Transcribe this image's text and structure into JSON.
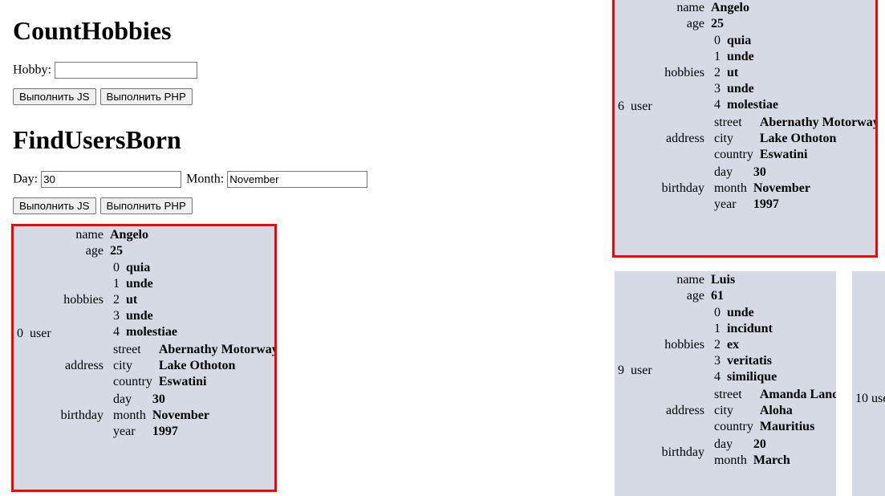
{
  "page": {
    "background": "#ffffff",
    "panel_background": "#d6dae4",
    "panel_border_color": "#ff0000"
  },
  "forms": [
    {
      "title": "CountHobbies",
      "fields": [
        {
          "label": "Hobby:",
          "value": "",
          "placeholder": ""
        }
      ],
      "buttons": [
        {
          "label": "Выполнить JS"
        },
        {
          "label": "Выполнить PHP"
        }
      ]
    },
    {
      "title": "FindUsersBorn",
      "fields": [
        {
          "label": "Day:",
          "value": "30",
          "placeholder": ""
        },
        {
          "label": "Month:",
          "value": "November",
          "placeholder": ""
        }
      ],
      "buttons": [
        {
          "label": "Выполнить JS"
        },
        {
          "label": "Выполнить PHP"
        }
      ]
    }
  ],
  "panels": [
    {
      "id": "panel-0",
      "index": "0",
      "root_key": "user",
      "bordered": true,
      "truncated": false,
      "rows": {
        "name_key": "name",
        "name_val": "Angelo",
        "age_key": "age",
        "age_val": "25",
        "hobbies_key": "hobbies",
        "hobbies": [
          {
            "i": "0",
            "v": "quia"
          },
          {
            "i": "1",
            "v": "unde"
          },
          {
            "i": "2",
            "v": "ut"
          },
          {
            "i": "3",
            "v": "unde"
          },
          {
            "i": "4",
            "v": "molestiae"
          }
        ],
        "address_key": "address",
        "address": [
          {
            "k": "street",
            "v": "Abernathy Motorway"
          },
          {
            "k": "city",
            "v": "Lake Othoton"
          },
          {
            "k": "country",
            "v": "Eswatini"
          }
        ],
        "birthday_key": "birthday",
        "birthday": [
          {
            "k": "day",
            "v": "30"
          },
          {
            "k": "month",
            "v": "November"
          },
          {
            "k": "year",
            "v": "1997"
          }
        ]
      }
    },
    {
      "id": "panel-6",
      "index": "6",
      "root_key": "user",
      "bordered": true,
      "truncated": false,
      "rows": {
        "name_key": "name",
        "name_val": "Angelo",
        "age_key": "age",
        "age_val": "25",
        "hobbies_key": "hobbies",
        "hobbies": [
          {
            "i": "0",
            "v": "quia"
          },
          {
            "i": "1",
            "v": "unde"
          },
          {
            "i": "2",
            "v": "ut"
          },
          {
            "i": "3",
            "v": "unde"
          },
          {
            "i": "4",
            "v": "molestiae"
          }
        ],
        "address_key": "address",
        "address": [
          {
            "k": "street",
            "v": "Abernathy Motorway"
          },
          {
            "k": "city",
            "v": "Lake Othoton"
          },
          {
            "k": "country",
            "v": "Eswatini"
          }
        ],
        "birthday_key": "birthday",
        "birthday": [
          {
            "k": "day",
            "v": "30"
          },
          {
            "k": "month",
            "v": "November"
          },
          {
            "k": "year",
            "v": "1997"
          }
        ]
      }
    },
    {
      "id": "panel-9",
      "index": "9",
      "root_key": "user",
      "bordered": false,
      "truncated": true,
      "rows": {
        "name_key": "name",
        "name_val": "Luis",
        "age_key": "age",
        "age_val": "61",
        "hobbies_key": "hobbies",
        "hobbies": [
          {
            "i": "0",
            "v": "unde"
          },
          {
            "i": "1",
            "v": "incidunt"
          },
          {
            "i": "2",
            "v": "ex"
          },
          {
            "i": "3",
            "v": "veritatis"
          },
          {
            "i": "4",
            "v": "similique"
          }
        ],
        "address_key": "address",
        "address": [
          {
            "k": "street",
            "v": "Amanda Land"
          },
          {
            "k": "city",
            "v": "Aloha"
          },
          {
            "k": "country",
            "v": "Mauritius"
          }
        ],
        "birthday_key": "birthday",
        "birthday": [
          {
            "k": "day",
            "v": "20"
          },
          {
            "k": "month",
            "v": "March"
          }
        ]
      }
    },
    {
      "id": "panel-10",
      "index": "10",
      "root_key": "user",
      "bordered": false,
      "truncated": true,
      "clipped_label": "10  use"
    }
  ]
}
